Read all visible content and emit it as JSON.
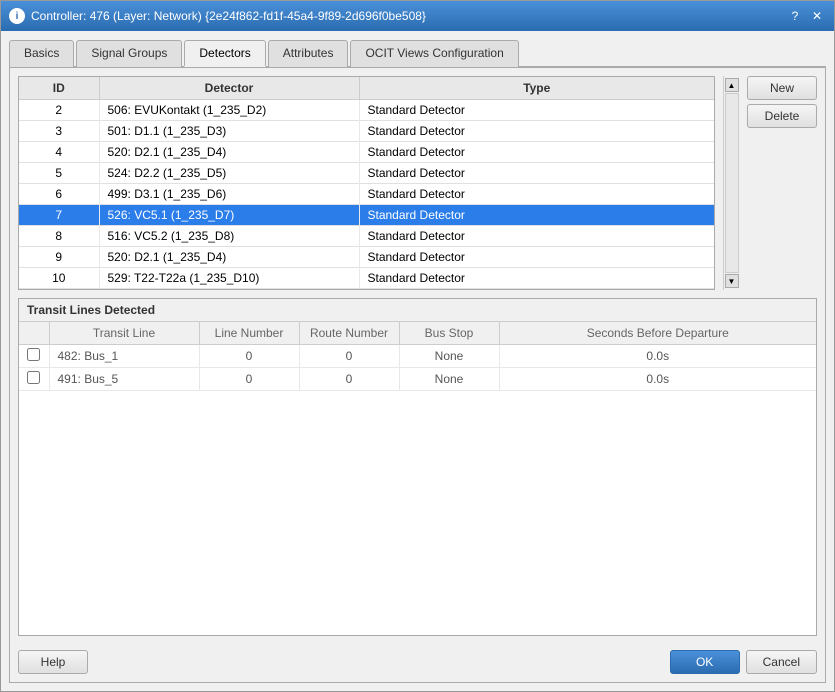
{
  "window": {
    "title": "Controller: 476 (Layer: Network) {2e24f862-fd1f-45a4-9f89-2d696f0be508}",
    "icon": "C",
    "help_question": "?",
    "close": "✕"
  },
  "tabs": [
    {
      "id": "basics",
      "label": "Basics",
      "active": false
    },
    {
      "id": "signal-groups",
      "label": "Signal Groups",
      "active": false
    },
    {
      "id": "detectors",
      "label": "Detectors",
      "active": true
    },
    {
      "id": "attributes",
      "label": "Attributes",
      "active": false
    },
    {
      "id": "ocit-views",
      "label": "OCIT Views Configuration",
      "active": false
    }
  ],
  "detector_table": {
    "columns": [
      "ID",
      "Detector",
      "Type"
    ],
    "rows": [
      {
        "id": "2",
        "detector": "506: EVUKontakt (1_235_D2)",
        "type": "Standard Detector",
        "selected": false
      },
      {
        "id": "3",
        "detector": "501: D1.1 (1_235_D3)",
        "type": "Standard Detector",
        "selected": false
      },
      {
        "id": "4",
        "detector": "520: D2.1 (1_235_D4)",
        "type": "Standard Detector",
        "selected": false
      },
      {
        "id": "5",
        "detector": "524: D2.2 (1_235_D5)",
        "type": "Standard Detector",
        "selected": false
      },
      {
        "id": "6",
        "detector": "499: D3.1 (1_235_D6)",
        "type": "Standard Detector",
        "selected": false
      },
      {
        "id": "7",
        "detector": "526: VC5.1 (1_235_D7)",
        "type": "Standard Detector",
        "selected": true
      },
      {
        "id": "8",
        "detector": "516: VC5.2 (1_235_D8)",
        "type": "Standard Detector",
        "selected": false
      },
      {
        "id": "9",
        "detector": "520: D2.1 (1_235_D4)",
        "type": "Standard Detector",
        "selected": false
      },
      {
        "id": "10",
        "detector": "529: T22-T22a (1_235_D10)",
        "type": "Standard Detector",
        "selected": false
      }
    ]
  },
  "buttons": {
    "new": "New",
    "delete": "Delete"
  },
  "transit": {
    "section_title": "Transit Lines Detected",
    "columns": [
      "Transit Line",
      "Line Number",
      "Route Number",
      "Bus Stop",
      "Seconds Before Departure"
    ],
    "rows": [
      {
        "checked": false,
        "line": "482: Bus_1",
        "line_number": "0",
        "route_number": "0",
        "bus_stop": "None",
        "seconds": "0.0s"
      },
      {
        "checked": false,
        "line": "491: Bus_5",
        "line_number": "0",
        "route_number": "0",
        "bus_stop": "None",
        "seconds": "0.0s"
      }
    ]
  },
  "footer": {
    "help": "Help",
    "ok": "OK",
    "cancel": "Cancel"
  },
  "colors": {
    "selected_row_bg": "#2b7de9",
    "selected_row_text": "#ffffff",
    "link_color": "#2b7de9",
    "header_color": "#6a9bd4"
  }
}
